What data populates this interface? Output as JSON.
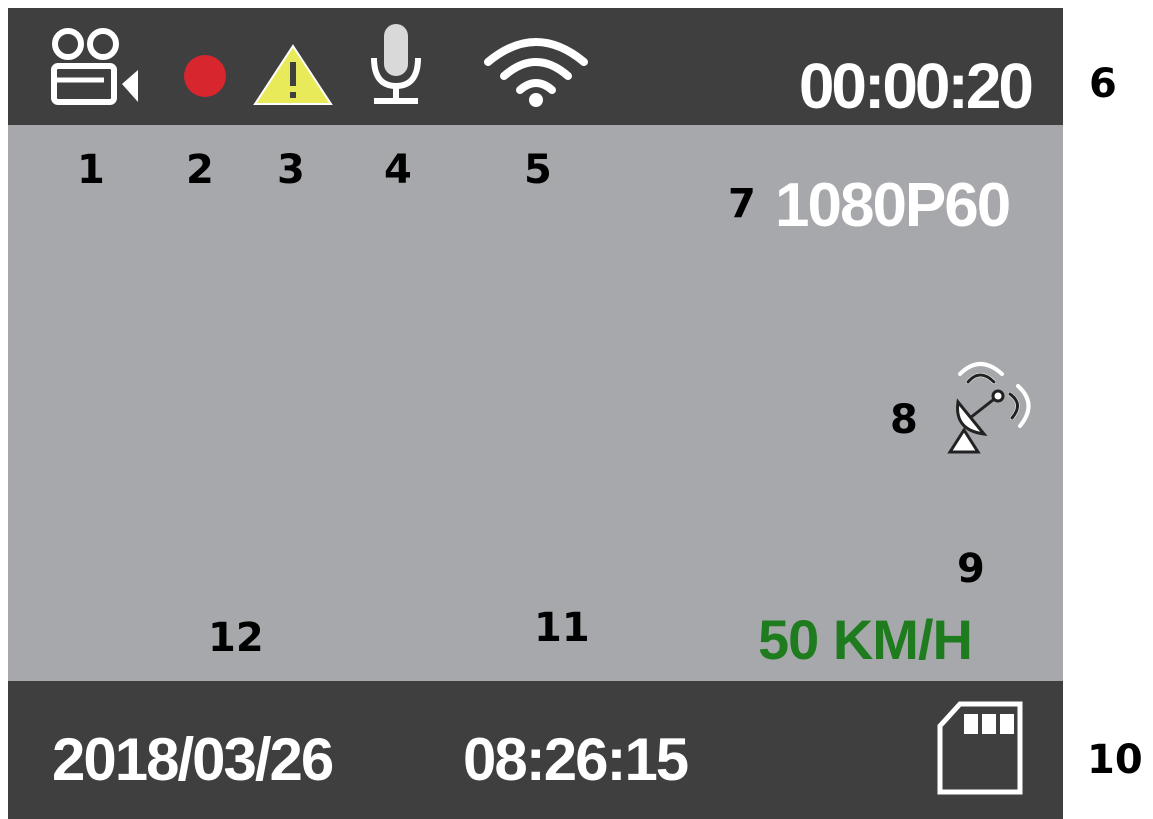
{
  "top_bar": {
    "timer": "00:00:20"
  },
  "overlay": {
    "resolution": "1080P60",
    "speed": "50 KM/H"
  },
  "bottom_bar": {
    "date": "2018/03/26",
    "time": "08:26:15"
  },
  "callouts": [
    "1",
    "2",
    "3",
    "4",
    "5",
    "6",
    "7",
    "8",
    "9",
    "10",
    "11",
    "12"
  ],
  "icons": {
    "camera": "video-camera-icon",
    "record": "record-dot-icon",
    "warning": "warning-icon",
    "microphone": "microphone-icon",
    "wifi": "wifi-icon",
    "gps": "gps-satellite-icon",
    "sd_card": "sd-card-icon"
  },
  "colors": {
    "bar": "#3f3f3f",
    "screen": "#a7a8ac",
    "record": "#d8262e",
    "warning": "#e8ea5a",
    "speed": "#1e7c1e"
  }
}
